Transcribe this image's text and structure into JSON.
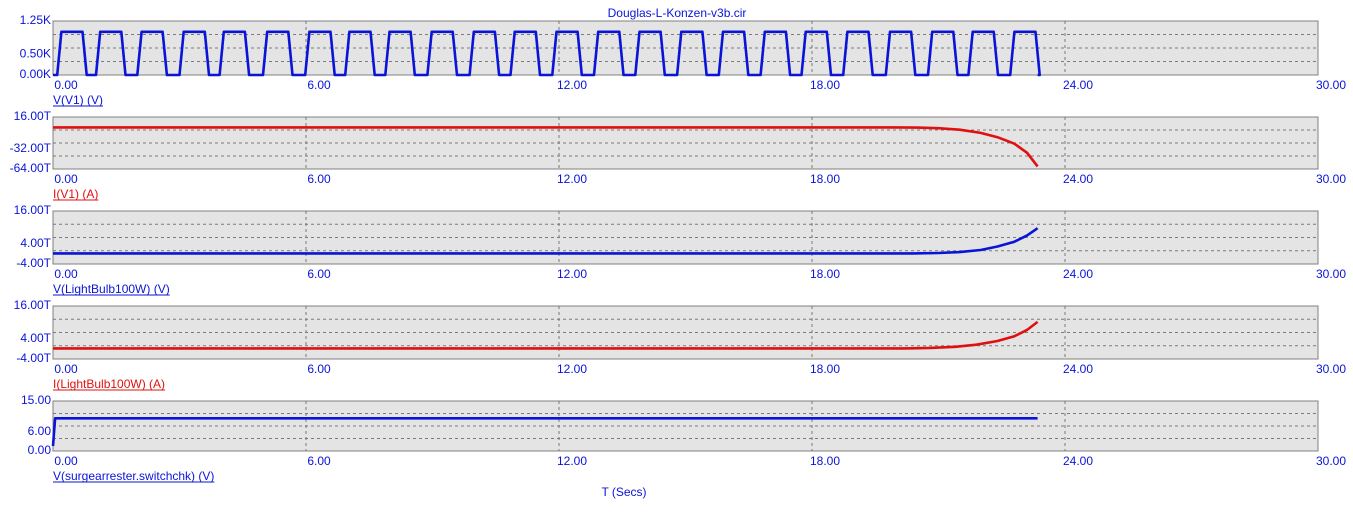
{
  "window": {
    "title": "Douglas-L-Konzen-v3b.cir"
  },
  "xaxis": {
    "label": "T (Secs)",
    "range": [
      0,
      30
    ],
    "ticks": [
      "0.00",
      "6.00",
      "12.00",
      "18.00",
      "24.00",
      "30.00"
    ],
    "tick_values": [
      0,
      6,
      12,
      18,
      24,
      30
    ]
  },
  "colors": {
    "blue": "#0a14d8",
    "red": "#e01010",
    "plot_bg": "#e4e4e4",
    "grid": "#7a7a7a"
  },
  "chart_data": [
    {
      "type": "line",
      "name": "V(V1) (V)",
      "color": "blue",
      "ylim": [
        0,
        1250
      ],
      "yticks": [
        "1.25K",
        "0.50K",
        "0.00K"
      ],
      "ytick_values": [
        1250,
        500,
        0
      ],
      "pulse": {
        "high": 1000,
        "low": 0,
        "starts": [
          0.1,
          1.02,
          2.0,
          3.0,
          3.95,
          4.98,
          5.98,
          6.93,
          7.88,
          8.88,
          9.88,
          10.85,
          11.84,
          12.83,
          13.81,
          14.8,
          15.79,
          16.78,
          17.75,
          18.74,
          19.75,
          20.75,
          21.71,
          22.7
        ],
        "rise": 0.1,
        "width": 0.5,
        "end": 23.35
      }
    },
    {
      "type": "line",
      "name": "I(V1) (A)",
      "color": "red",
      "ylim": [
        -64,
        16
      ],
      "yticks": [
        "16.00T",
        "-32.00T",
        "-64.00T"
      ],
      "ytick_values": [
        16,
        -32,
        -64
      ],
      "y_unit": "T",
      "x": [
        0,
        20.0,
        20.5,
        21.0,
        21.5,
        22.0,
        22.4,
        22.8,
        23.1,
        23.35
      ],
      "y": [
        0,
        0,
        -0.3,
        -1.2,
        -3.5,
        -8.5,
        -15,
        -25,
        -39,
        -60
      ]
    },
    {
      "type": "line",
      "name": "V(LightBulb100W) (V)",
      "color": "blue",
      "ylim": [
        -4,
        16
      ],
      "yticks": [
        "16.00T",
        "4.00T",
        "-4.00T"
      ],
      "ytick_values": [
        16,
        4,
        -4
      ],
      "y_unit": "T",
      "x": [
        0,
        20.4,
        21.0,
        21.5,
        22.0,
        22.4,
        22.8,
        23.1,
        23.35
      ],
      "y": [
        0,
        0,
        0.15,
        0.5,
        1.3,
        2.6,
        4.4,
        6.8,
        9.5
      ]
    },
    {
      "type": "line",
      "name": "I(LightBulb100W) (A)",
      "color": "red",
      "ylim": [
        -4,
        16
      ],
      "yticks": [
        "16.00T",
        "4.00T",
        "-4.00T"
      ],
      "ytick_values": [
        16,
        4,
        -4
      ],
      "y_unit": "T",
      "x": [
        0,
        20.2,
        20.8,
        21.4,
        21.9,
        22.4,
        22.8,
        23.1,
        23.35
      ],
      "y": [
        0,
        0,
        0.2,
        0.6,
        1.4,
        2.8,
        4.6,
        7.0,
        10.0
      ]
    },
    {
      "type": "line",
      "name": "V(surgearrester.switchchk) (V)",
      "color": "blue",
      "ylim": [
        0,
        15
      ],
      "yticks": [
        "15.00",
        "6.00",
        "0.00"
      ],
      "ytick_values": [
        15,
        6,
        0
      ],
      "x": [
        0,
        0.05,
        0.12,
        23.35
      ],
      "y": [
        1.5,
        9.8,
        9.8,
        9.8
      ]
    }
  ]
}
